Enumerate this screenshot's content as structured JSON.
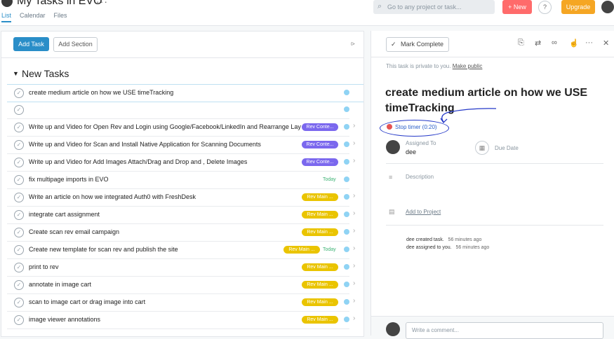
{
  "header": {
    "title": "My Tasks in EVO",
    "more": "···",
    "tabs": [
      "List",
      "Calendar",
      "Files"
    ],
    "search_placeholder": "Go to any project or task...",
    "new_label": "+ New",
    "help_label": "?",
    "upgrade_label": "Upgrade"
  },
  "toolbar": {
    "add_task": "Add Task",
    "add_section": "Add Section"
  },
  "section": {
    "title": "New Tasks"
  },
  "tasks": [
    {
      "name": "create medium article on how we USE timeTracking",
      "tag": "",
      "tag_color": "",
      "today": ""
    },
    {
      "name": "",
      "tag": "",
      "tag_color": "",
      "today": ""
    },
    {
      "name": " Write up and Video for Open Rev and Login using Google/Facebook/LinkedIn and Rearrange Lay",
      "tag": "Rev Conte...",
      "tag_color": "purple",
      "today": ""
    },
    {
      "name": "Write up and Video for Scan and Install Native Application for Scanning Documents",
      "tag": "Rev Conte...",
      "tag_color": "purple",
      "today": ""
    },
    {
      "name": "Write up and Video for Add Images Attach/Drag and Drop and , Delete Images",
      "tag": "Rev Conte...",
      "tag_color": "purple",
      "today": ""
    },
    {
      "name": "fix multipage imports in EVO",
      "tag": "",
      "tag_color": "",
      "today": "Today"
    },
    {
      "name": "Write an article on how we integrated Auth0 with FreshDesk",
      "tag": "Rev Main ...",
      "tag_color": "yellow",
      "today": ""
    },
    {
      "name": "integrate cart assignment",
      "tag": "Rev Main ...",
      "tag_color": "yellow",
      "today": ""
    },
    {
      "name": "Create scan rev email  campaign",
      "tag": "Rev Main ...",
      "tag_color": "yellow",
      "today": ""
    },
    {
      "name": "Create new template for scan rev and publish the site",
      "tag": "Rev Main ...",
      "tag_color": "yellow",
      "today": "Today"
    },
    {
      "name": "print to rev",
      "tag": "Rev Main ...",
      "tag_color": "yellow",
      "today": ""
    },
    {
      "name": "annotate in image cart",
      "tag": "Rev Main ...",
      "tag_color": "yellow",
      "today": ""
    },
    {
      "name": "scan to image cart or drag image into cart",
      "tag": "Rev Main ...",
      "tag_color": "yellow",
      "today": ""
    },
    {
      "name": "image viewer annotations",
      "tag": "Rev Main ...",
      "tag_color": "yellow",
      "today": ""
    }
  ],
  "detail": {
    "mark_complete": "Mark Complete",
    "private_text": "This task is private to you.",
    "make_public": "Make public",
    "title": "create medium article on how we USE timeTracking",
    "timer": "Stop timer (0:20)",
    "assigned_label": "Assigned To",
    "assigned_value": "dee",
    "due_label": "Due Date",
    "description_label": "Description",
    "add_project": "Add to Project",
    "activity": [
      {
        "text": "dee created task.",
        "time": "56 minutes ago"
      },
      {
        "text": "dee assigned to you.",
        "time": "56 minutes ago"
      }
    ],
    "comment_placeholder": "Write a comment..."
  },
  "colors": {
    "accent": "#2a8ec8",
    "new_button": "#ff6b6b",
    "upgrade": "#f5a623",
    "tag_purple": "#7b68ee",
    "tag_yellow": "#eac400"
  },
  "icons": [
    "search-icon",
    "checkmark-icon",
    "attachment-icon",
    "subtask-icon",
    "link-icon",
    "like-icon",
    "more-icon",
    "close-icon",
    "calendar-icon",
    "description-icon",
    "project-icon",
    "filter-icon",
    "timer-icon"
  ]
}
